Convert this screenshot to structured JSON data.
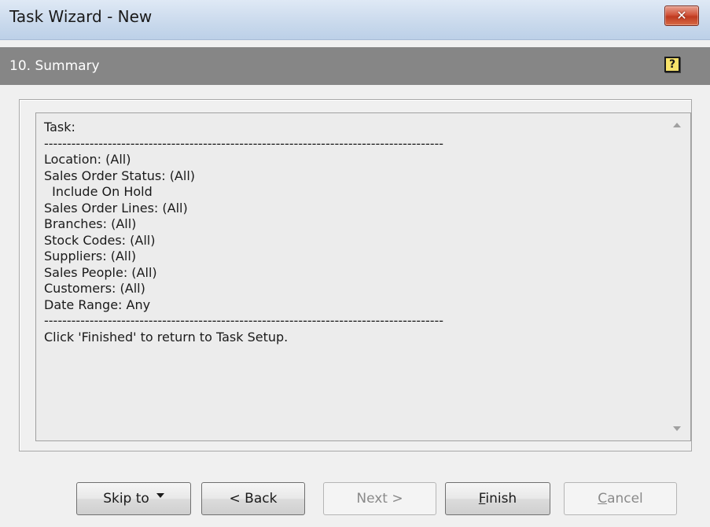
{
  "window": {
    "title": "Task Wizard - New",
    "close_label": "✕"
  },
  "step": {
    "title": "10. Summary",
    "help_label": "?"
  },
  "summary": {
    "lines": [
      "Task:",
      "----------------------------------------------------------------------------------------",
      "Location: (All)",
      "Sales Order Status: (All)",
      "  Include On Hold",
      "Sales Order Lines: (All)",
      "Branches: (All)",
      "Stock Codes: (All)",
      "Suppliers: (All)",
      "Sales People: (All)",
      "Customers: (All)",
      "Date Range: Any",
      "----------------------------------------------------------------------------------------",
      "Click 'Finished' to return to Task Setup."
    ]
  },
  "buttons": {
    "skip_to": "Skip to",
    "back": "< Back",
    "next": "Next >",
    "finish": "Finish",
    "cancel": "Cancel"
  },
  "icons": {
    "close": "close-icon",
    "help": "help-icon",
    "scroll_up": "scroll-up-arrow-icon",
    "scroll_down": "scroll-down-arrow-icon",
    "dropdown": "chevron-down-icon"
  },
  "colors": {
    "step_bar": "#868686",
    "close_button": "#c9462b",
    "help_icon": "#f8e36a"
  }
}
